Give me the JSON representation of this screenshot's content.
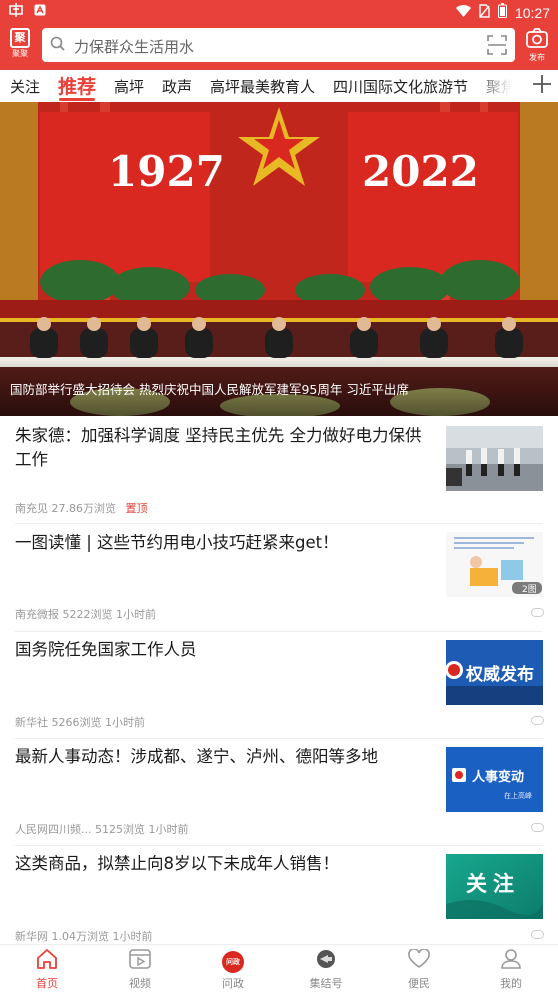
{
  "status_bar": {
    "time": "10:27"
  },
  "header": {
    "left_logo": {
      "glyph": "聚",
      "label": "聚聚"
    },
    "search_placeholder": "力保群众生活用水",
    "publish_label": "发布",
    "colors": {
      "brand_red": "#e8413a"
    }
  },
  "tabs": [
    "关注",
    "推荐",
    "高坪",
    "政声",
    "高坪最美教育人",
    "四川国际文化旅游节",
    "聚焦"
  ],
  "active_tab": "推荐",
  "banner": {
    "year_left": "1927",
    "year_right": "2022",
    "caption": "国防部举行盛大招待会 热烈庆祝中国人民解放军建军95周年 习近平出席"
  },
  "news": [
    {
      "title": "朱家德：加强科学调度 坚持民主优先 全力做好电力保供工作",
      "source": "南充见",
      "views": "27.86万浏览",
      "tag": "置顶",
      "time": ""
    },
    {
      "title": "一图读懂 | 这些节约用电小技巧赶紧来get！",
      "source": "南充微报",
      "views": "5222浏览",
      "time": "1小时前",
      "thumb_badge": "2图"
    },
    {
      "title": "国务院任免国家工作人员",
      "source": "新华社",
      "views": "5266浏览",
      "time": "1小时前",
      "thumb_text": "权威发布"
    },
    {
      "title": "最新人事动态！涉成都、遂宁、泸州、德阳等多地",
      "source": "人民网四川频...",
      "views": "5125浏览",
      "time": "1小时前",
      "thumb_text": "人事变动",
      "thumb_subtext": "在上高峰"
    },
    {
      "title": "这类商品，拟禁止向8岁以下未成年人销售！",
      "source": "新华网",
      "views": "1.04万浏览",
      "time": "1小时前",
      "thumb_text": "关注"
    }
  ],
  "bottom_nav": [
    {
      "label": "首页",
      "icon": "home-icon"
    },
    {
      "label": "视频",
      "icon": "video-icon"
    },
    {
      "label": "问政",
      "icon": "wenzheng-icon",
      "badge": "问政"
    },
    {
      "label": "集结号",
      "icon": "bugle-icon"
    },
    {
      "label": "便民",
      "icon": "heart-icon"
    },
    {
      "label": "我的",
      "icon": "user-icon"
    }
  ]
}
